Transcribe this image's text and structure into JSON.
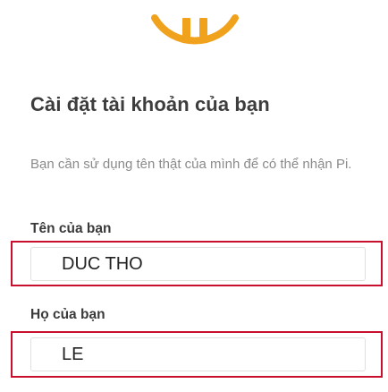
{
  "branding": {
    "logo_icon": "pi-smile-logo-icon",
    "logo_color": "#f0a21d"
  },
  "header": {
    "title": "Cài đặt tài khoản của bạn"
  },
  "description": "Bạn cần sử dụng tên thật của mình để có thể nhận Pi.",
  "form": {
    "first_name": {
      "label": "Tên của bạn",
      "value": "DUC THO"
    },
    "last_name": {
      "label": "Họ của bạn",
      "value": "LE"
    }
  },
  "highlight_color": "#c8102e"
}
